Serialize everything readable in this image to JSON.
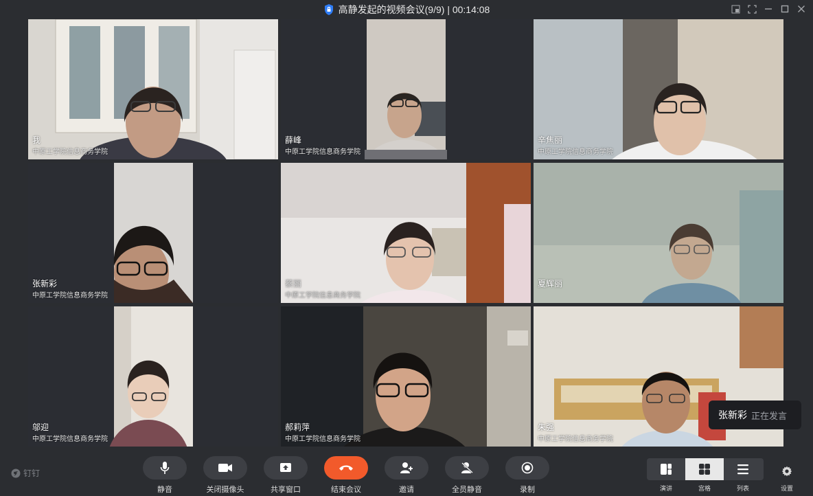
{
  "window": {
    "title": "高静发起的视频会议(9/9) | 00:14:08"
  },
  "participants": [
    {
      "name": "我",
      "org": "中原工学院信息商务学院"
    },
    {
      "name": "薛峰",
      "org": "中原工学院信息商务学院"
    },
    {
      "name": "辛焦丽",
      "org": "中原工学院信息商务学院"
    },
    {
      "name": "张新彩",
      "org": "中原工学院信息商务学院"
    },
    {
      "name": "蔡丽",
      "org": "中原工学院信息商务学院"
    },
    {
      "name": "夏辉丽",
      "org": ""
    },
    {
      "name": "邬迎",
      "org": "中原工学院信息商务学院"
    },
    {
      "name": "郝莉萍",
      "org": "中原工学院信息商务学院"
    },
    {
      "name": "朱强",
      "org": "中原工学院信息商务学院"
    }
  ],
  "speaker_toast": {
    "name": "张新彩",
    "status": "正在发言"
  },
  "brand": {
    "label": "钉钉"
  },
  "toolbar": {
    "mute": "静音",
    "camera_off": "关闭摄像头",
    "share_window": "共享窗口",
    "end_meeting": "结束会议",
    "invite": "邀请",
    "mute_all": "全员静音",
    "record": "录制"
  },
  "layout": {
    "lecture": "演讲",
    "grid": "宫格",
    "list": "列表",
    "active": "grid"
  },
  "settings": {
    "label": "设置"
  },
  "colors": {
    "background": "#2b2d31",
    "speaking_border": "#1fb35a",
    "end_button": "#f25a2b",
    "button": "#3d3f44"
  }
}
